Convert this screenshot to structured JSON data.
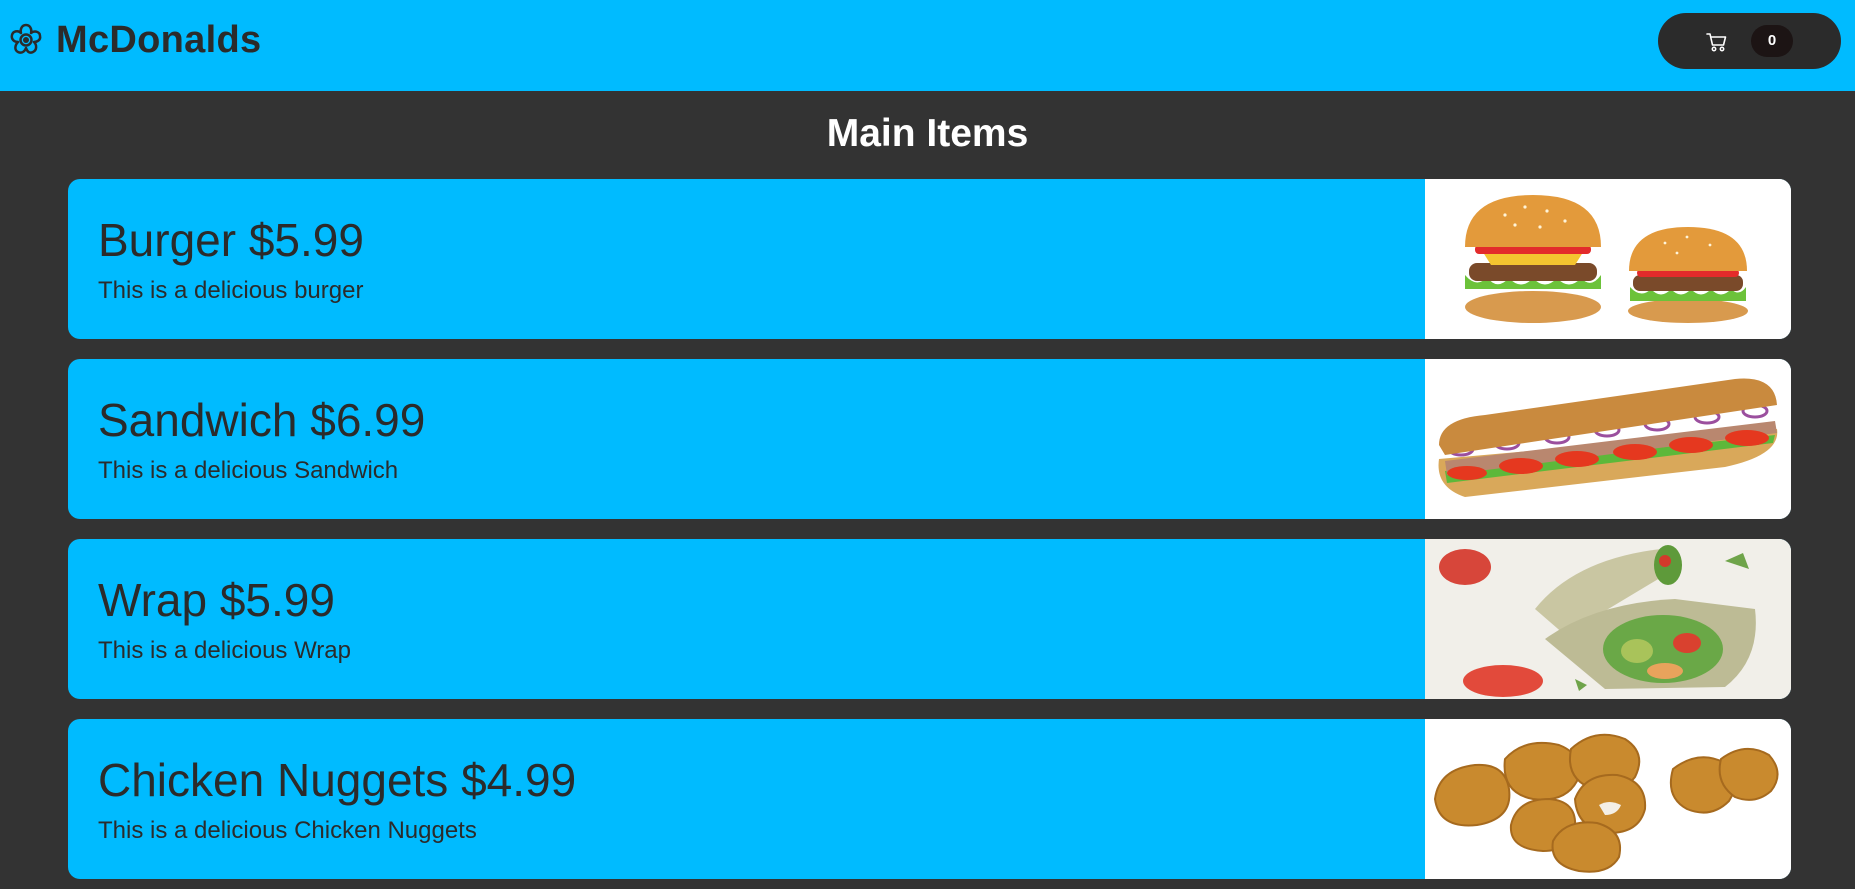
{
  "header": {
    "brand_name": "McDonalds",
    "brand_icon": "flower-logo-icon",
    "cart": {
      "icon": "cart-icon",
      "count": "0"
    }
  },
  "section_title": "Main Items",
  "items": [
    {
      "title": "Burger $5.99",
      "description": "This is a delicious burger",
      "image": "burger-image"
    },
    {
      "title": "Sandwich $6.99",
      "description": "This is a delicious Sandwich",
      "image": "sandwich-image"
    },
    {
      "title": "Wrap $5.99",
      "description": "This is a delicious Wrap",
      "image": "wrap-image"
    },
    {
      "title": "Chicken Nuggets $4.99",
      "description": "This is a delicious Chicken Nuggets",
      "image": "nuggets-image"
    }
  ],
  "colors": {
    "header_bg": "#00bbff",
    "page_bg": "#333333",
    "card_bg": "#00bbff",
    "text": "#2b2b2b",
    "cart_bg": "#2b2b2b"
  }
}
